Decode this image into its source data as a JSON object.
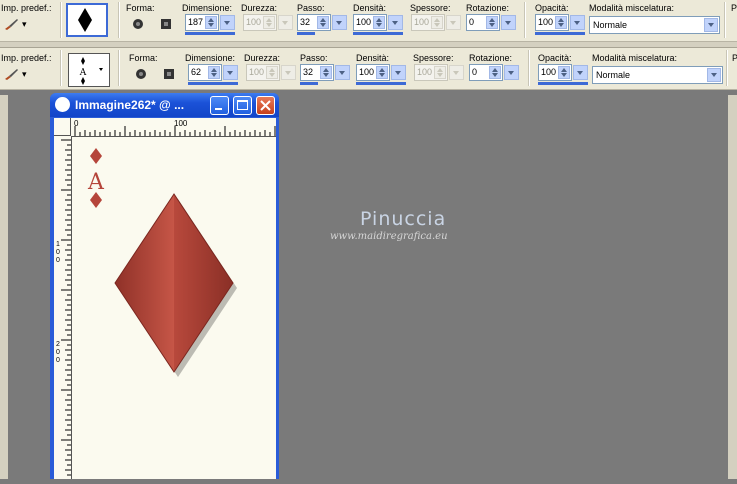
{
  "toolbar1": {
    "preset_label": "Imp. predef.:",
    "shape_label": "Forma:",
    "size_label": "Dimensione:",
    "size_value": "187",
    "hardness_label": "Durezza:",
    "hardness_value": "100",
    "step_label": "Passo:",
    "step_value": "32",
    "density_label": "Densità:",
    "density_value": "100",
    "thickness_label": "Spessore:",
    "thickness_value": "100",
    "rotation_label": "Rotazione:",
    "rotation_value": "0",
    "opacity_label": "Opacità:",
    "opacity_value": "100",
    "blend_label": "Modalità miscelatura:",
    "blend_value": "Normale",
    "extra_label": "P"
  },
  "toolbar2": {
    "preset_label": "Imp. predef.:",
    "shape_label": "Forma:",
    "size_label": "Dimensione:",
    "size_value": "62",
    "hardness_label": "Durezza:",
    "hardness_value": "100",
    "step_label": "Passo:",
    "step_value": "32",
    "density_label": "Densità:",
    "density_value": "100",
    "thickness_label": "Spessore:",
    "thickness_value": "100",
    "rotation_label": "Rotazione:",
    "rotation_value": "0",
    "opacity_label": "Opacità:",
    "opacity_value": "100",
    "blend_label": "Modalità miscelatura:",
    "blend_value": "Normale",
    "extra_label": "P"
  },
  "window": {
    "title": "Immagine262* @ ...",
    "ruler_zero": "0",
    "ruler_hundred": "100",
    "ruler_v_100": "100",
    "ruler_v_200": "200",
    "card_rank": "A"
  },
  "watermark": {
    "name": "Pinuccia",
    "url": "www.maidiregrafica.eu"
  },
  "colors": {
    "diamond": "#b5453a",
    "canvas": "#fbfaef",
    "workspace": "#7a7a7a",
    "accent": "#3d6ad6"
  }
}
